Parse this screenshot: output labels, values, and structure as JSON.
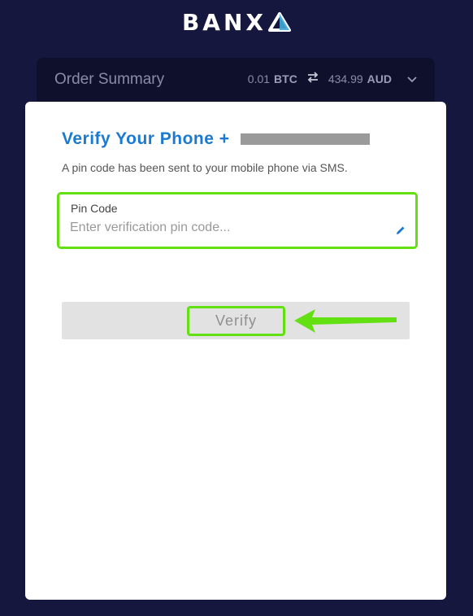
{
  "brand": {
    "logo_text": "BANX",
    "logo_mark": "banxa-triangle-icon"
  },
  "order_summary": {
    "title": "Order Summary",
    "from_amount": "0.01",
    "from_currency": "BTC",
    "to_amount": "434.99",
    "to_currency": "AUD",
    "swap_icon": "swap-arrows-icon",
    "expand_icon": "chevron-down-icon"
  },
  "verify": {
    "title": "Verify Your Phone +",
    "info": "A pin code has been sent to your mobile phone via SMS.",
    "pin_label": "Pin Code",
    "pin_placeholder": "Enter verification pin code...",
    "pin_value": "",
    "edit_icon": "pencil-icon",
    "button_label": "Verify"
  },
  "colors": {
    "background": "#16173f",
    "accent_blue": "#1a7ad1",
    "highlight_green": "#62e012"
  }
}
